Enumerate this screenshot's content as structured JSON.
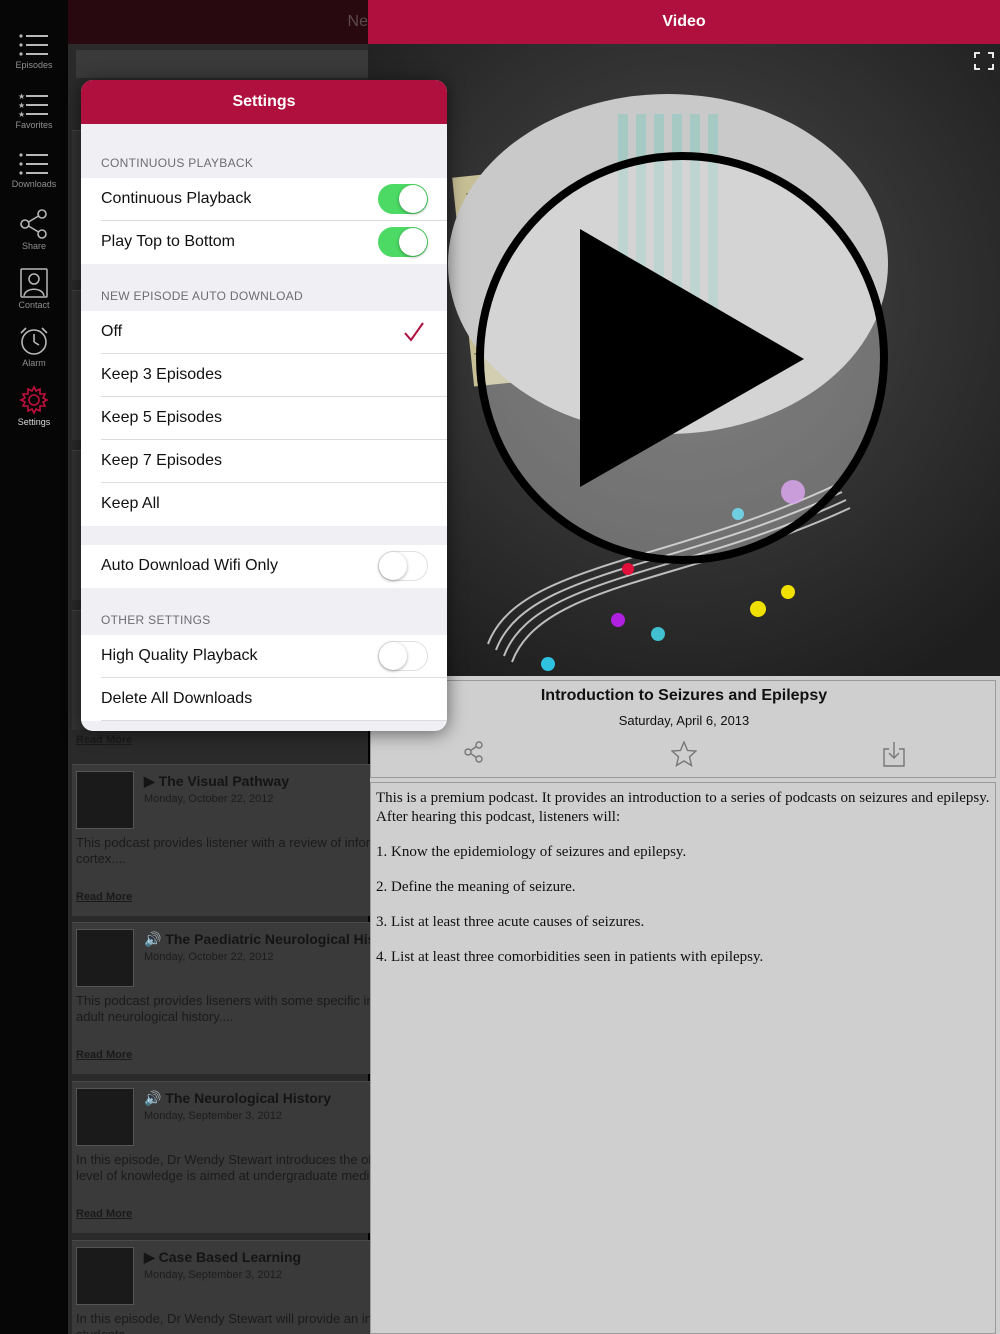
{
  "sidebar": {
    "items": [
      {
        "label": "Episodes"
      },
      {
        "label": "Favorites"
      },
      {
        "label": "Downloads"
      },
      {
        "label": "Share"
      },
      {
        "label": "Contact"
      },
      {
        "label": "Alarm"
      },
      {
        "label": "Settings"
      }
    ]
  },
  "left_panel": {
    "header_title": "Neurology",
    "read_more": "Read More",
    "episodes": [
      {
        "title": "The Visual Pathway",
        "date": "Monday, October 22, 2012",
        "desc": "This podcast provides listener with a review of information from the retina to the occipital cortex...."
      },
      {
        "title": "The Paediatric Neurological History",
        "date": "Monday, October 22, 2012",
        "desc": "This podcast provides liseners with some specific information related to the paediatric versus the adult neurological history...."
      },
      {
        "title": "The Neurological History",
        "date": "Monday, September 3, 2012",
        "desc": "In this episode, Dr Wendy Stewart introduces the older child and adult neurological history. The level of knowledge is aimed at undergraduate medical students...."
      },
      {
        "title": "Case Based Learning",
        "date": "Monday, September 3, 2012",
        "desc": "In this episode, Dr Wendy Stewart will provide an introduction to case based learning for students...."
      }
    ]
  },
  "video": {
    "header_title": "Video",
    "episode_title": "Introduction to Seizures and Epilepsy",
    "episode_date": "Saturday, April 6, 2013",
    "description": [
      "This is a premium podcast. It provides an introduction to a series of podcasts on seizures and epilepsy. After hearing this podcast, listeners will:",
      "1. Know the epidemiology of seizures and epilepsy.",
      "2. Define the meaning of seizure.",
      "3. List at least three acute causes of seizures.",
      "4. List at least three comorbidities seen in patients with epilepsy."
    ]
  },
  "settings": {
    "title": "Settings",
    "continuous_header": "CONTINUOUS PLAYBACK",
    "continuous_playback": {
      "label": "Continuous Playback",
      "on": true
    },
    "play_top_to_bottom": {
      "label": "Play Top to Bottom",
      "on": true
    },
    "auto_download_header": "NEW EPISODE AUTO DOWNLOAD",
    "download_options": [
      "Off",
      "Keep 3 Episodes",
      "Keep 5 Episodes",
      "Keep 7 Episodes",
      "Keep All"
    ],
    "selected_option": "Off",
    "wifi_only": {
      "label": "Auto Download Wifi Only",
      "on": false
    },
    "other_header": "OTHER SETTINGS",
    "high_quality": {
      "label": "High Quality Playback",
      "on": false
    },
    "delete_all": "Delete All Downloads"
  },
  "colors": {
    "accent": "#b0103e",
    "toggle_on": "#4cd964"
  }
}
